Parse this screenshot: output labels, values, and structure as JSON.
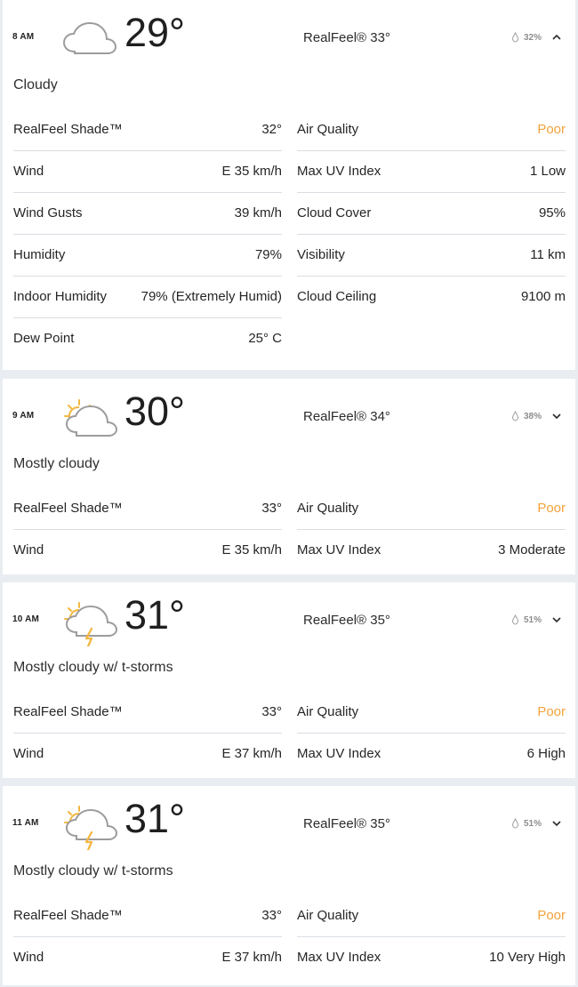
{
  "hours": [
    {
      "time": "8 AM",
      "temp": "29°",
      "realfeel": "RealFeel® 33°",
      "precip": "32%",
      "condition": "Cloudy",
      "icon": "cloud-icon",
      "expanded": true,
      "details_left": [
        {
          "label": "RealFeel Shade™",
          "value": "32°"
        },
        {
          "label": "Wind",
          "value": "E 35 km/h"
        },
        {
          "label": "Wind Gusts",
          "value": "39 km/h"
        },
        {
          "label": "Humidity",
          "value": "79%"
        },
        {
          "label": "Indoor Humidity",
          "value": "79% (Extremely Humid)"
        },
        {
          "label": "Dew Point",
          "value": "25° C"
        }
      ],
      "details_right": [
        {
          "label": "Air Quality",
          "value": "Poor"
        },
        {
          "label": "Max UV Index",
          "value": "1 Low"
        },
        {
          "label": "Cloud Cover",
          "value": "95%"
        },
        {
          "label": "Visibility",
          "value": "11 km"
        },
        {
          "label": "Cloud Ceiling",
          "value": "9100 m"
        }
      ]
    },
    {
      "time": "9 AM",
      "temp": "30°",
      "realfeel": "RealFeel® 34°",
      "precip": "38%",
      "condition": "Mostly cloudy",
      "icon": "partly-sunny-cloud-icon",
      "expanded": false,
      "details_left": [
        {
          "label": "RealFeel Shade™",
          "value": "33°"
        },
        {
          "label": "Wind",
          "value": "E 35 km/h"
        }
      ],
      "details_right": [
        {
          "label": "Air Quality",
          "value": "Poor"
        },
        {
          "label": "Max UV Index",
          "value": "3 Moderate"
        }
      ]
    },
    {
      "time": "10 AM",
      "temp": "31°",
      "realfeel": "RealFeel® 35°",
      "precip": "51%",
      "condition": "Mostly cloudy w/ t-storms",
      "icon": "thunderstorm-sun-cloud-icon",
      "expanded": false,
      "details_left": [
        {
          "label": "RealFeel Shade™",
          "value": "33°"
        },
        {
          "label": "Wind",
          "value": "E 37 km/h"
        }
      ],
      "details_right": [
        {
          "label": "Air Quality",
          "value": "Poor"
        },
        {
          "label": "Max UV Index",
          "value": "6 High"
        }
      ]
    },
    {
      "time": "11 AM",
      "temp": "31°",
      "realfeel": "RealFeel® 35°",
      "precip": "51%",
      "condition": "Mostly cloudy w/ t-storms",
      "icon": "thunderstorm-sun-cloud-icon",
      "expanded": false,
      "details_left": [
        {
          "label": "RealFeel Shade™",
          "value": "33°"
        },
        {
          "label": "Wind",
          "value": "E 37 km/h"
        }
      ],
      "details_right": [
        {
          "label": "Air Quality",
          "value": "Poor"
        },
        {
          "label": "Max UV Index",
          "value": "10 Very High"
        }
      ]
    }
  ],
  "colors": {
    "page_bg": "#e9edf2",
    "card_bg": "#ffffff",
    "divider": "#d9dde3",
    "aq_poor": "#f3a23a",
    "muted": "#8d8d8d"
  }
}
